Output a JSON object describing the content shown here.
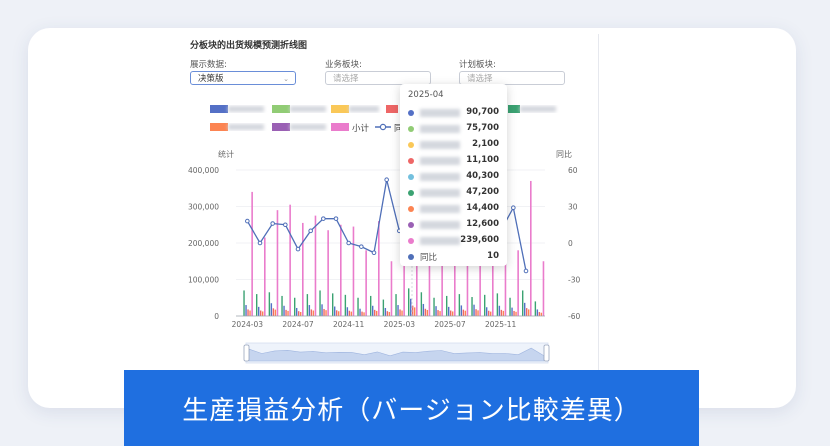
{
  "banner": {
    "text": "生産損益分析（バージョン比較差異）"
  },
  "panel": {
    "title": "分板块的出货规模预测折线图",
    "filters": [
      {
        "label": "展示数据:",
        "value": "决策版",
        "placeholder": ""
      },
      {
        "label": "业务板块:",
        "value": "",
        "placeholder": "请选择"
      },
      {
        "label": "计划板块:",
        "value": "",
        "placeholder": "请选择"
      }
    ]
  },
  "legend": {
    "subtotal_label": "小计",
    "yoy_label_partial": "同"
  },
  "colors": {
    "blue": "#5470c6",
    "green": "#91cc75",
    "yellow": "#fac858",
    "red": "#ee6666",
    "cyan": "#73c0de",
    "darkgreen": "#3ba272",
    "orange": "#fc8452",
    "purple": "#9a60b4",
    "pink": "#ea7ccc",
    "line": "#4f6fb8"
  },
  "tooltip": {
    "title": "2025-04",
    "rows": [
      {
        "color": "blue",
        "name": "",
        "value": "90,700"
      },
      {
        "color": "green",
        "name": "",
        "value": "75,700"
      },
      {
        "color": "yellow",
        "name": "",
        "value": "2,100"
      },
      {
        "color": "red",
        "name": "",
        "value": "11,100"
      },
      {
        "color": "cyan",
        "name": "",
        "value": "40,300"
      },
      {
        "color": "darkgreen",
        "name": "",
        "value": "47,200"
      },
      {
        "color": "orange",
        "name": "",
        "value": "14,400"
      },
      {
        "color": "purple",
        "name": "",
        "value": "12,600"
      },
      {
        "color": "pink",
        "name": "",
        "value": "239,600"
      },
      {
        "color": "line",
        "name": "同比",
        "value": "10"
      }
    ]
  },
  "chart_data": {
    "type": "bar",
    "left_axis": {
      "title": "统计",
      "ticks": [
        "400,000",
        "300,000",
        "200,000",
        "100,000",
        "0"
      ],
      "range": [
        0,
        400000
      ]
    },
    "right_axis": {
      "title": "同比",
      "ticks": [
        "60",
        "30",
        "0",
        "-30",
        "-60"
      ],
      "range": [
        -60,
        60
      ]
    },
    "x_tick_labels": [
      "2024-03",
      "2024-07",
      "2024-11",
      "2025-03",
      "2025-07",
      "2025-11"
    ],
    "months": [
      "2024-03",
      "2024-04",
      "2024-05",
      "2024-06",
      "2024-07",
      "2024-08",
      "2024-09",
      "2024-10",
      "2024-11",
      "2024-12",
      "2025-01",
      "2025-02",
      "2025-03",
      "2025-04",
      "2025-05",
      "2025-06",
      "2025-07",
      "2025-08",
      "2025-09",
      "2025-10",
      "2025-11",
      "2025-12",
      "2026-01",
      "2026-02"
    ],
    "subtotal": [
      340000,
      215000,
      290000,
      305000,
      255000,
      275000,
      235000,
      250000,
      245000,
      180000,
      260000,
      150000,
      255000,
      239600,
      280000,
      300000,
      210000,
      230000,
      240000,
      210000,
      215000,
      180000,
      370000,
      150000
    ],
    "yoy": [
      18,
      0,
      16,
      15,
      -5,
      10,
      20,
      20,
      0,
      -3,
      -8,
      52,
      10,
      10,
      12,
      11,
      10,
      12,
      10,
      10,
      10,
      29,
      -23,
      null
    ],
    "green_series": [
      70000,
      60000,
      65000,
      55000,
      50000,
      60000,
      70000,
      62000,
      58000,
      50000,
      55000,
      45000,
      60000,
      75700,
      65000,
      50000,
      55000,
      60000,
      52000,
      58000,
      62000,
      50000,
      70000,
      40000
    ],
    "other_series": [
      30000,
      25000,
      35000,
      28000,
      22000,
      30000,
      32000,
      26000,
      24000,
      20000,
      28000,
      22000,
      30000,
      47200,
      33000,
      27000,
      25000,
      29000,
      31000,
      24000,
      28000,
      23000,
      36000,
      18000
    ],
    "marked_month": "2025-04"
  }
}
